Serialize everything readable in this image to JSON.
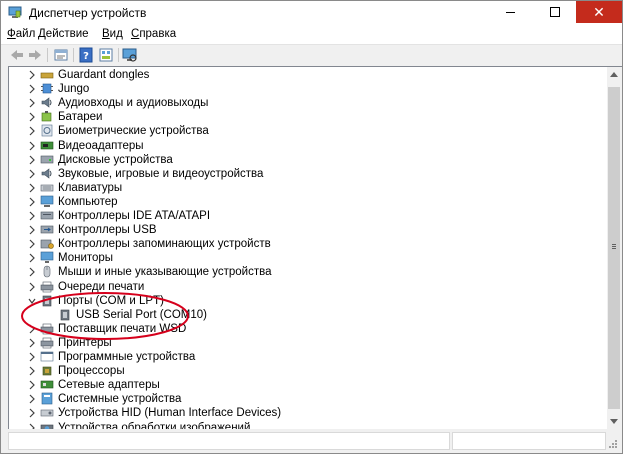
{
  "window": {
    "title": "Диспетчер устройств",
    "close_glyph": "✕"
  },
  "menu": [
    {
      "key": "Ф",
      "rest": "айл"
    },
    {
      "key": "Д",
      "rest": "ействие"
    },
    {
      "key": "В",
      "rest": "ид"
    },
    {
      "key": "С",
      "rest": "правка"
    }
  ],
  "tree": {
    "items": [
      {
        "label": "Guardant dongles",
        "icon": "key-icon",
        "expanded": false
      },
      {
        "label": "Jungo",
        "icon": "chip-icon",
        "expanded": false
      },
      {
        "label": "Аудиовходы и аудиовыходы",
        "icon": "speaker-icon",
        "expanded": false
      },
      {
        "label": "Батареи",
        "icon": "battery-icon",
        "expanded": false
      },
      {
        "label": "Биометрические устройства",
        "icon": "fingerprint-icon",
        "expanded": false
      },
      {
        "label": "Видеоадаптеры",
        "icon": "display-adapter-icon",
        "expanded": false
      },
      {
        "label": "Дисковые устройства",
        "icon": "disk-icon",
        "expanded": false
      },
      {
        "label": "Звуковые, игровые и видеоустройства",
        "icon": "speaker-icon",
        "expanded": false
      },
      {
        "label": "Клавиатуры",
        "icon": "keyboard-icon",
        "expanded": false
      },
      {
        "label": "Компьютер",
        "icon": "computer-icon",
        "expanded": false
      },
      {
        "label": "Контроллеры IDE ATA/ATAPI",
        "icon": "controller-icon",
        "expanded": false
      },
      {
        "label": "Контроллеры USB",
        "icon": "usb-icon",
        "expanded": false
      },
      {
        "label": "Контроллеры запоминающих устройств",
        "icon": "storage-controller-icon",
        "expanded": false
      },
      {
        "label": "Мониторы",
        "icon": "monitor-icon",
        "expanded": false
      },
      {
        "label": "Мыши и иные указывающие устройства",
        "icon": "mouse-icon",
        "expanded": false
      },
      {
        "label": "Очереди печати",
        "icon": "printer-icon",
        "expanded": false
      },
      {
        "label": "Порты (COM и LPT)",
        "icon": "port-icon",
        "expanded": true
      },
      {
        "label": "USB Serial Port (COM10)",
        "icon": "port-icon",
        "child": true
      },
      {
        "label": "Поставщик печати WSD",
        "icon": "printer-icon",
        "expanded": false
      },
      {
        "label": "Принтеры",
        "icon": "printer-icon",
        "expanded": false
      },
      {
        "label": "Программные устройства",
        "icon": "software-device-icon",
        "expanded": false
      },
      {
        "label": "Процессоры",
        "icon": "processor-icon",
        "expanded": false
      },
      {
        "label": "Сетевые адаптеры",
        "icon": "network-adapter-icon",
        "expanded": false
      },
      {
        "label": "Системные устройства",
        "icon": "system-device-icon",
        "expanded": false
      },
      {
        "label": "Устройства HID (Human Interface Devices)",
        "icon": "hid-icon",
        "expanded": false
      },
      {
        "label": "Устройства обработки изображений",
        "icon": "camera-icon",
        "expanded": false
      }
    ]
  },
  "colors": {
    "highlight": "#d6001c",
    "close_button": "#c42b1c"
  }
}
